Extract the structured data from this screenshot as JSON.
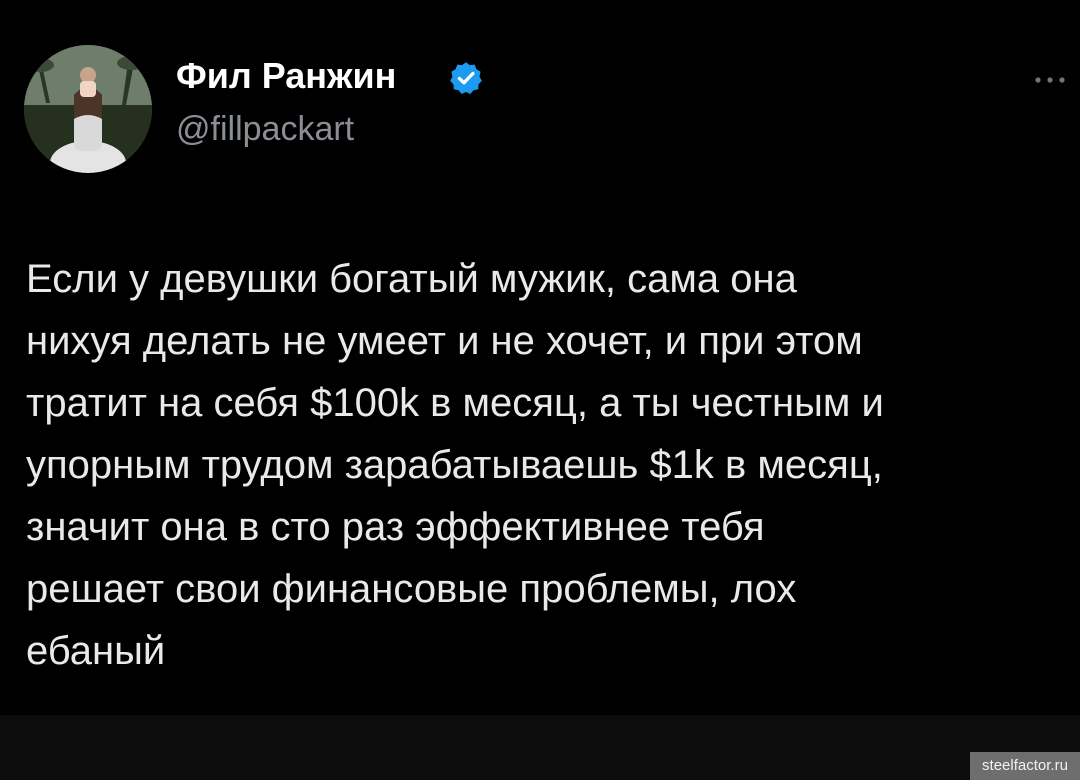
{
  "author": {
    "name": "Фил Ранжин",
    "handle": "@fillpackart",
    "verified": true
  },
  "tweet": {
    "text": "Если у девушки богатый мужик, сама она\nнихуя делать не умеет и не хочет, и при этом\nтратит на себя $100k в месяц, а ты честным и\nупорным трудом зарабатываешь $1k в месяц,\nзначит она в сто раз эффективнее тебя\nрешает свои финансовые проблемы, лох\nебаный"
  },
  "watermark": "steelfactor.ru",
  "colors": {
    "background": "#000000",
    "text": "#e7e9ea",
    "secondary_text": "#8b8f94",
    "verified_badge": "#1d9bf0"
  },
  "icons": {
    "verified": "verified-badge-icon",
    "more": "more-options-icon"
  }
}
